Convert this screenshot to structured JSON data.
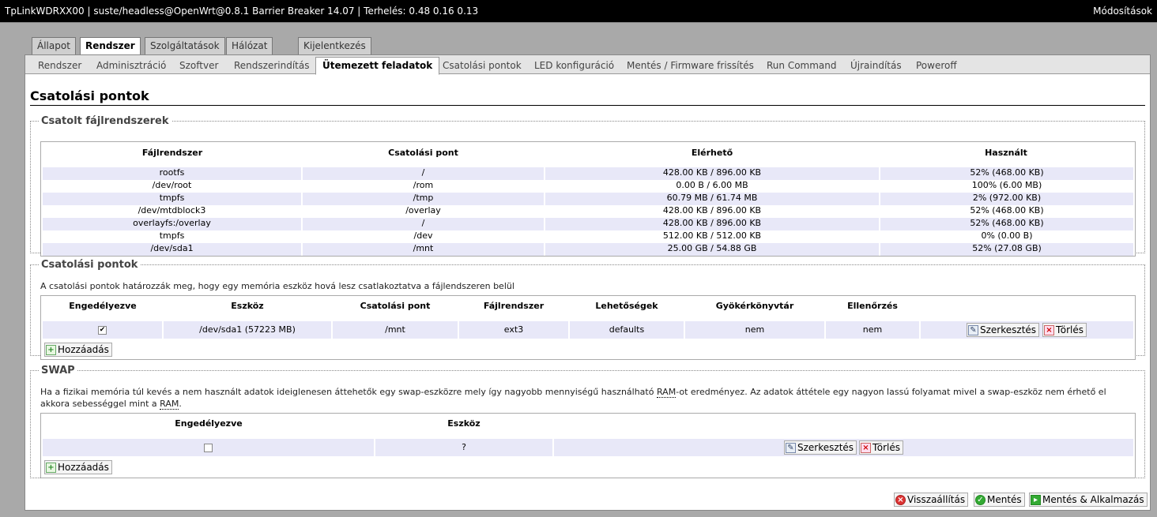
{
  "header": {
    "title": "TpLinkWDRXX00 | suste/headless@OpenWrt@0.8.1 Barrier Breaker 14.07 | Terhelés: 0.48 0.16 0.13",
    "changes": "Módosítások"
  },
  "main_tabs": [
    "Állapot",
    "Rendszer",
    "Szolgáltatások",
    "Hálózat",
    "Kijelentkezés"
  ],
  "sub_tabs": [
    "Rendszer",
    "Adminisztráció",
    "Szoftver",
    "Rendszerindítás",
    "Ütemezett feladatok",
    "Csatolási pontok",
    "LED konfiguráció",
    "Mentés / Firmware frissítés",
    "Run Command",
    "Újraindítás",
    "Poweroff"
  ],
  "page_title": "Csatolási pontok",
  "mounted": {
    "legend": "Csatolt fájlrendszerek",
    "headers": [
      "Fájlrendszer",
      "Csatolási pont",
      "Elérhető",
      "Használt"
    ],
    "rows": [
      [
        "rootfs",
        "/",
        "428.00 KB / 896.00 KB",
        "52% (468.00 KB)"
      ],
      [
        "/dev/root",
        "/rom",
        "0.00 B / 6.00 MB",
        "100% (6.00 MB)"
      ],
      [
        "tmpfs",
        "/tmp",
        "60.79 MB / 61.74 MB",
        "2% (972.00 KB)"
      ],
      [
        "/dev/mtdblock3",
        "/overlay",
        "428.00 KB / 896.00 KB",
        "52% (468.00 KB)"
      ],
      [
        "overlayfs:/overlay",
        "/",
        "428.00 KB / 896.00 KB",
        "52% (468.00 KB)"
      ],
      [
        "tmpfs",
        "/dev",
        "512.00 KB / 512.00 KB",
        "0% (0.00 B)"
      ],
      [
        "/dev/sda1",
        "/mnt",
        "25.00 GB / 54.88 GB",
        "52% (27.08 GB)"
      ]
    ]
  },
  "mountpoints": {
    "legend": "Csatolási pontok",
    "description": "A csatolási pontok határozzák meg, hogy egy memória eszköz hová lesz csatlakoztatva a fájlendszeren belül",
    "headers": [
      "Engedélyezve",
      "Eszköz",
      "Csatolási pont",
      "Fájlrendszer",
      "Lehetőségek",
      "Gyökérkönyvtár",
      "Ellenőrzés"
    ],
    "row": {
      "enabled": "✔",
      "device": "/dev/sda1 (57223 MB)",
      "mountpoint": "/mnt",
      "fs": "ext3",
      "options": "defaults",
      "root": "nem",
      "check": "nem"
    },
    "edit_label": "Szerkesztés",
    "delete_label": "Törlés",
    "add_label": "Hozzáadás"
  },
  "swap": {
    "legend": "SWAP",
    "desc_line1_a": "Ha a fizikai memória túl kevés a nem használt adatok ideiglenesen áttehetők egy swap-eszközre mely így nagyobb mennyiségű használható ",
    "desc_ram": "RAM",
    "desc_line1_b": "-ot eredményez. Az adatok áttétele egy nagyon lassú folyamat mivel a swap-eszköz nem érhető el",
    "desc_line2_a": "akkora sebességgel mint a ",
    "desc_line2_b": ".",
    "headers": [
      "Engedélyezve",
      "Eszköz"
    ],
    "row": {
      "device": "?"
    },
    "edit_label": "Szerkesztés",
    "delete_label": "Törlés",
    "add_label": "Hozzáadás"
  },
  "footer": {
    "reset_label": "Visszaállítás",
    "save_label": "Mentés",
    "save_apply_label": "Mentés & Alkalmazás"
  }
}
